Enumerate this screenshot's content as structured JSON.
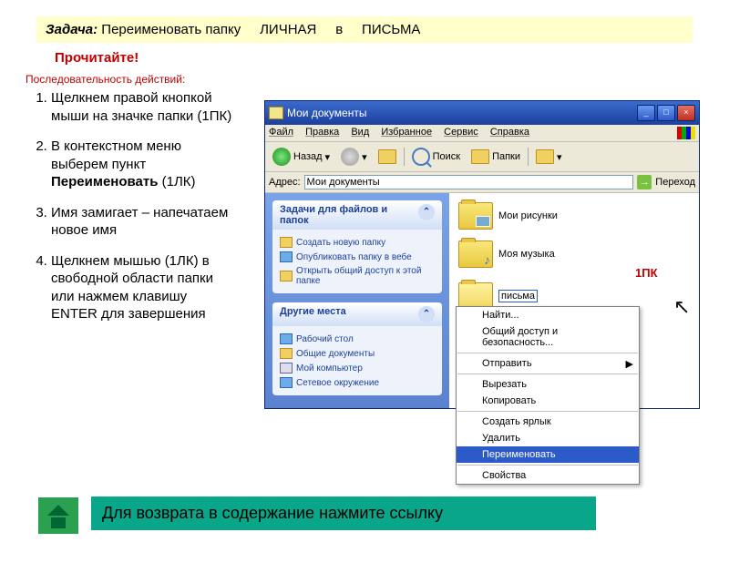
{
  "task": {
    "label": "Задача:",
    "text": "Переименовать папку",
    "from": "ЛИЧНАЯ",
    "mid": "в",
    "to": "ПИСЬМА"
  },
  "read": "Прочитайте!",
  "seq": "Последовательность действий:",
  "steps": [
    "Щелкнем правой кнопкой мыши на значке папки (1ПК)",
    "В контекстном меню выберем пункт <b>Переименовать</b> (1ЛК)",
    "Имя замигает – напечатаем новое имя",
    "Щелкнем мышью (1ЛК) в свободной области папки или нажмем клавишу ENTER для завершения"
  ],
  "window": {
    "title": "Мои документы"
  },
  "menus": [
    "Файл",
    "Правка",
    "Вид",
    "Избранное",
    "Сервис",
    "Справка"
  ],
  "toolbar": {
    "back": "Назад",
    "search": "Поиск",
    "folders": "Папки"
  },
  "address": {
    "label": "Адрес:",
    "value": "Мои документы",
    "go": "Переход"
  },
  "sidebar": {
    "tasks": {
      "title": "Задачи для файлов и папок",
      "items": [
        "Создать новую папку",
        "Опубликовать папку в вебе",
        "Открыть общий доступ к этой папке"
      ]
    },
    "places": {
      "title": "Другие места",
      "items": [
        "Рабочий стол",
        "Общие документы",
        "Мой компьютер",
        "Сетевое окружение"
      ]
    }
  },
  "folders": {
    "pics": "Мои рисунки",
    "music": "Моя музыка",
    "rename": "письма"
  },
  "marker": "1ПК",
  "ctx": [
    "Найти...",
    "Общий доступ и безопасность...",
    "Отправить",
    "Вырезать",
    "Копировать",
    "Создать ярлык",
    "Удалить",
    "Переименовать",
    "Свойства"
  ],
  "return": "Для возврата в содержание нажмите ссылку"
}
